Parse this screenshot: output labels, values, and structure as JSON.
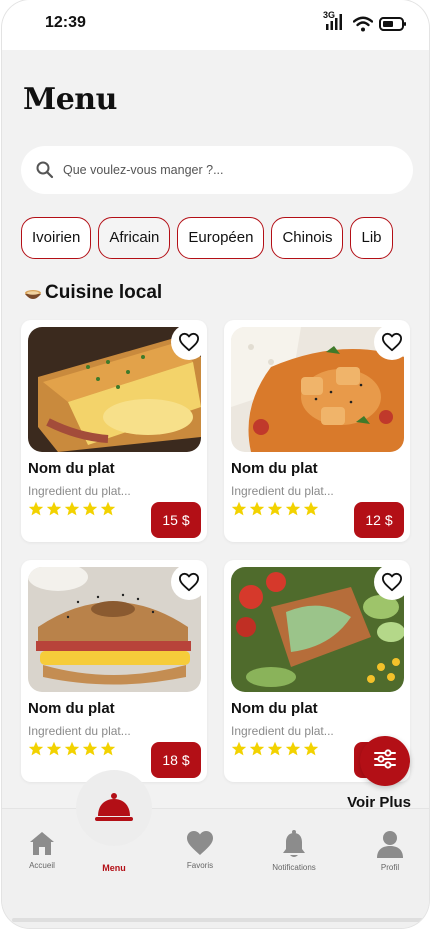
{
  "status": {
    "time": "12:39",
    "network": "3G"
  },
  "page": {
    "title": "Menu"
  },
  "search": {
    "placeholder": "Que voulez-vous manger ?..."
  },
  "categories": [
    {
      "label": "Ivoirien",
      "active": false
    },
    {
      "label": "Africain",
      "active": true
    },
    {
      "label": "Européen",
      "active": false
    },
    {
      "label": "Chinois",
      "active": false
    },
    {
      "label": "Lib",
      "active": false
    }
  ],
  "section": {
    "title": "Cuisine local",
    "icon": "bowl-icon"
  },
  "dishes": [
    {
      "name": "Nom du plat",
      "ingredients": "Ingredient du plat...",
      "rating": 5,
      "price": "15 $",
      "image": "croque-monsieur"
    },
    {
      "name": "Nom du plat",
      "ingredients": "Ingredient du plat...",
      "rating": 5,
      "price": "12 $",
      "image": "chicken-curry-rice"
    },
    {
      "name": "Nom du plat",
      "ingredients": "Ingredient du plat...",
      "rating": 5,
      "price": "18 $",
      "image": "bagel-sandwich"
    },
    {
      "name": "Nom du plat",
      "ingredients": "Ingredient du plat...",
      "rating": 5,
      "price": "",
      "image": "chicken-salad"
    }
  ],
  "more": {
    "label": "Voir Plus"
  },
  "nav": {
    "accueil": "Accueil",
    "menu": "Menu",
    "favoris": "Favoris",
    "notifications": "Notifications",
    "profil": "Profil"
  },
  "colors": {
    "accent": "#b30f16",
    "star": "#f2d200",
    "background": "#f2f2f2"
  }
}
